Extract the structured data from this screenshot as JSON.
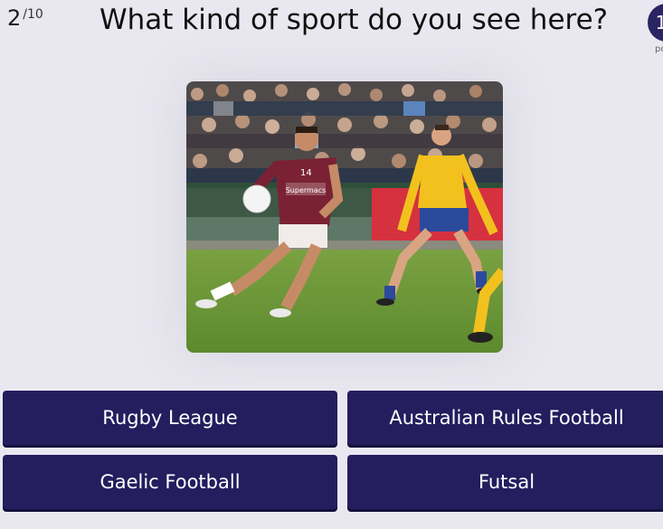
{
  "progress": {
    "current": "2",
    "total": "/10"
  },
  "question": "What kind of sport do you see here?",
  "points": {
    "badge": "1",
    "label": "po"
  },
  "image": {
    "icon": "sport-photo",
    "jersey_text": "Supermacs",
    "jersey_number": "14"
  },
  "answers": [
    "Rugby League",
    "Australian Rules Football",
    "Gaelic Football",
    "Futsal"
  ],
  "colors": {
    "background": "#e9e8f0",
    "answer_button": "#241d5e",
    "badge": "#2b2463"
  }
}
